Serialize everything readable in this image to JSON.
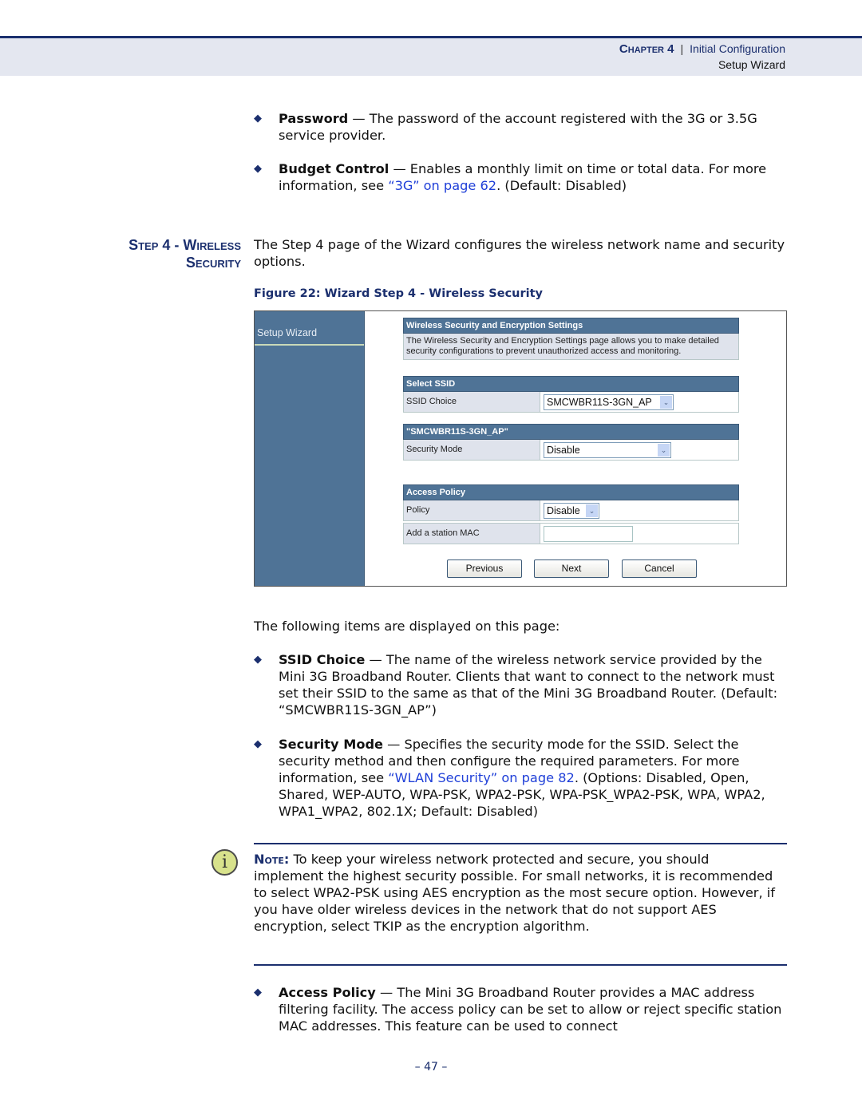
{
  "header": {
    "chapter": "Chapter 4",
    "separator": "|",
    "section": "Initial Configuration",
    "subsection": "Setup Wizard"
  },
  "top_bullets": [
    {
      "term": "Password",
      "text": " — The password of the account registered with the 3G or 3.5G service provider."
    },
    {
      "term": "Budget Control",
      "text_before": " — Enables a monthly limit on time or total data. For more information, see ",
      "link": "“3G” on page 62",
      "text_after": ". (Default: Disabled)"
    }
  ],
  "step": {
    "title_line1": "Step 4 - Wireless",
    "title_line2": "Security",
    "intro": "The Step 4 page of the Wizard configures the wireless network name and security options."
  },
  "figure": {
    "caption": "Figure 22:  Wizard Step 4 - Wireless Security",
    "sidebar_item": "Setup Wizard",
    "panels": {
      "settings_header": "Wireless Security and Encryption Settings",
      "settings_desc": "The Wireless Security and Encryption Settings page allows you to make detailed security configurations to prevent unauthorized access and monitoring.",
      "ssid_header": "Select SSID",
      "ssid_label": "SSID Choice",
      "ssid_value": "SMCWBR11S-3GN_AP",
      "ssid_section_header": "\"SMCWBR11S-3GN_AP\"",
      "security_mode_label": "Security Mode",
      "security_mode_value": "Disable",
      "access_header": "Access Policy",
      "policy_label": "Policy",
      "policy_value": "Disable",
      "mac_label": "Add a station MAC",
      "mac_value": ""
    },
    "buttons": {
      "previous": "Previous",
      "next": "Next",
      "cancel": "Cancel"
    }
  },
  "following": "The following items are displayed on this page:",
  "items": [
    {
      "term": "SSID Choice",
      "text": " — The name of the wireless network service provided by the Mini 3G Broadband Router. Clients that want to connect to the network must set their SSID to the same as that of the Mini 3G Broadband Router. (Default: “SMCWBR11S-3GN_AP”)"
    },
    {
      "term": "Security Mode",
      "text_before": " — Specifies the security mode for the SSID. Select the security method and then configure the required parameters. For more information, see ",
      "link": "“WLAN Security” on page 82",
      "text_after": ". (Options: Disabled, Open, Shared, WEP-AUTO, WPA-PSK, WPA2-PSK, WPA-PSK_WPA2-PSK, WPA, WPA2, WPA1_WPA2, 802.1X; Default: Disabled)"
    },
    {
      "term": "Access Policy",
      "text": " — The Mini 3G Broadband Router provides a MAC address filtering facility. The access policy can be set to allow or reject specific station MAC addresses. This feature can be used to connect"
    }
  ],
  "note": {
    "label": "Note:",
    "text": " To keep your wireless network protected and secure, you should implement the highest security possible. For small networks, it is recommended to select WPA2-PSK using AES encryption as the most secure option. However, if you have older wireless devices in the network that do not support AES encryption, select TKIP as the encryption algorithm."
  },
  "page_number": "–  47  –",
  "bullet_glyph": "◆",
  "icons": {
    "note": "i",
    "dropdown": "⌄"
  }
}
